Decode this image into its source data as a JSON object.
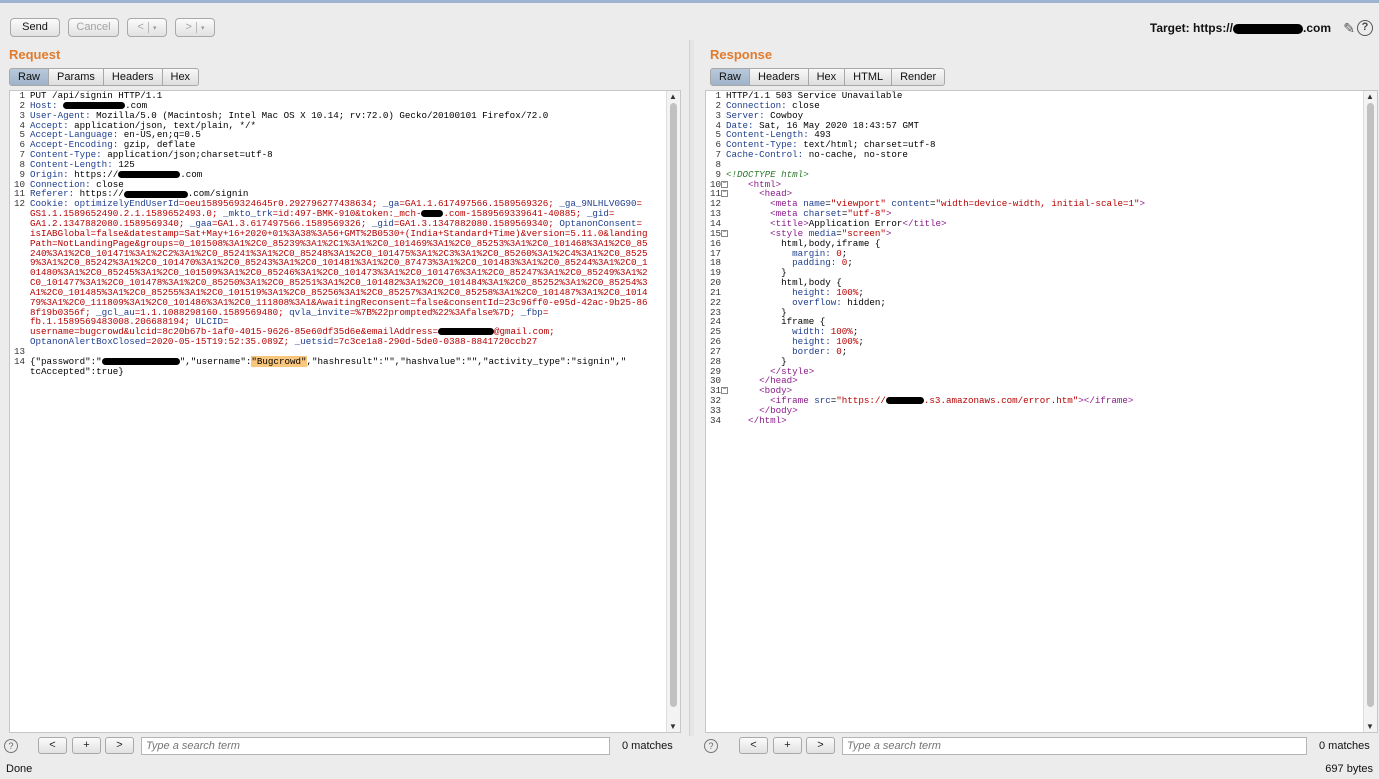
{
  "toolbar": {
    "send_label": "Send",
    "cancel_label": "Cancel",
    "back_label": "<",
    "forward_label": ">",
    "dropdown_glyph": "▾",
    "target_prefix": "Target: https://",
    "target_suffix": ".com"
  },
  "request": {
    "title": "Request",
    "tabs": [
      "Raw",
      "Params",
      "Headers",
      "Hex"
    ],
    "active_tab": "Raw",
    "lines": [
      {
        "n": "1",
        "parts": [
          {
            "t": "PUT /api/signin HTTP/1.1",
            "c": "val"
          }
        ]
      },
      {
        "n": "2",
        "parts": [
          {
            "t": "Host: ",
            "c": "hdr"
          },
          {
            "t": "",
            "c": "redact",
            "w": 62
          },
          {
            "t": ".com",
            "c": "val"
          }
        ]
      },
      {
        "n": "3",
        "parts": [
          {
            "t": "User-Agent: ",
            "c": "hdr"
          },
          {
            "t": "Mozilla/5.0 (Macintosh; Intel Mac OS X 10.14; rv:72.0) Gecko/20100101 Firefox/72.0",
            "c": "val"
          }
        ]
      },
      {
        "n": "4",
        "parts": [
          {
            "t": "Accept: ",
            "c": "hdr"
          },
          {
            "t": "application/json, text/plain, */*",
            "c": "val"
          }
        ]
      },
      {
        "n": "5",
        "parts": [
          {
            "t": "Accept-Language: ",
            "c": "hdr"
          },
          {
            "t": "en-US,en;q=0.5",
            "c": "val"
          }
        ]
      },
      {
        "n": "6",
        "parts": [
          {
            "t": "Accept-Encoding: ",
            "c": "hdr"
          },
          {
            "t": "gzip, deflate",
            "c": "val"
          }
        ]
      },
      {
        "n": "7",
        "parts": [
          {
            "t": "Content-Type: ",
            "c": "hdr"
          },
          {
            "t": "application/json;charset=utf-8",
            "c": "val"
          }
        ]
      },
      {
        "n": "8",
        "parts": [
          {
            "t": "Content-Length: ",
            "c": "hdr"
          },
          {
            "t": "125",
            "c": "val"
          }
        ]
      },
      {
        "n": "9",
        "parts": [
          {
            "t": "Origin: ",
            "c": "hdr"
          },
          {
            "t": "https://",
            "c": "val"
          },
          {
            "t": "",
            "c": "redact",
            "w": 62
          },
          {
            "t": ".com",
            "c": "val"
          }
        ]
      },
      {
        "n": "10",
        "parts": [
          {
            "t": "Connection: ",
            "c": "hdr"
          },
          {
            "t": "close",
            "c": "val"
          }
        ]
      },
      {
        "n": "11",
        "parts": [
          {
            "t": "Referer: ",
            "c": "hdr"
          },
          {
            "t": "https://",
            "c": "val"
          },
          {
            "t": "",
            "c": "redact",
            "w": 64
          },
          {
            "t": ".com/signin",
            "c": "val"
          }
        ]
      },
      {
        "n": "12",
        "parts": [
          {
            "t": "Cookie: ",
            "c": "hdr"
          },
          {
            "t": "optimizelyEndUserId",
            "c": "ck"
          },
          {
            "t": "=oeu1589569324645r0.292796277438634; ",
            "c": "cv"
          },
          {
            "t": "_ga",
            "c": "ck"
          },
          {
            "t": "=GA1.1.617497566.1589569326; ",
            "c": "cv"
          },
          {
            "t": "_ga_9NLHLV0G90",
            "c": "ck"
          },
          {
            "t": "=",
            "c": "cv"
          }
        ]
      },
      {
        "n": "",
        "parts": [
          {
            "t": "GS1.1.1589652490.2.1.1589652493.0; ",
            "c": "cv"
          },
          {
            "t": "_mkto_trk",
            "c": "ck"
          },
          {
            "t": "=id:497-BMK-910&token:_mch-",
            "c": "cv"
          },
          {
            "t": "",
            "c": "redact",
            "w": 22
          },
          {
            "t": ".com-1589569339641-40885; ",
            "c": "cv"
          },
          {
            "t": "_gid",
            "c": "ck"
          },
          {
            "t": "=",
            "c": "cv"
          }
        ]
      },
      {
        "n": "",
        "parts": [
          {
            "t": "GA1.2.1347882080.1589569340; ",
            "c": "cv"
          },
          {
            "t": "_gaa",
            "c": "ck"
          },
          {
            "t": "=GA1.3.617497566.1589569326; ",
            "c": "cv"
          },
          {
            "t": "_gid",
            "c": "ck"
          },
          {
            "t": "=GA1.3.1347882080.1589569340; ",
            "c": "cv"
          },
          {
            "t": "OptanonConsent",
            "c": "ck"
          },
          {
            "t": "=",
            "c": "cv"
          }
        ]
      },
      {
        "n": "",
        "parts": [
          {
            "t": "isIABGlobal=false&datestamp=Sat+May+16+2020+01%3A38%3A56+GMT%2B0530+(India+Standard+Time)&version=5.11.0&landing",
            "c": "cv"
          }
        ]
      },
      {
        "n": "",
        "parts": [
          {
            "t": "Path=NotLandingPage&groups=0_101508%3A1%2C0_85239%3A1%2C1%3A1%2C0_101469%3A1%2C0_85253%3A1%2C0_101468%3A1%2C0_85",
            "c": "cv"
          }
        ]
      },
      {
        "n": "",
        "parts": [
          {
            "t": "240%3A1%2C0_101471%3A1%2C2%3A1%2C0_85241%3A1%2C0_85248%3A1%2C0_101475%3A1%2C3%3A1%2C0_85260%3A1%2C4%3A1%2C0_8525",
            "c": "cv"
          }
        ]
      },
      {
        "n": "",
        "parts": [
          {
            "t": "9%3A1%2C0_85242%3A1%2C0_101470%3A1%2C0_85243%3A1%2C0_101481%3A1%2C0_87473%3A1%2C0_101483%3A1%2C0_85244%3A1%2C0_1",
            "c": "cv"
          }
        ]
      },
      {
        "n": "",
        "parts": [
          {
            "t": "01480%3A1%2C0_85245%3A1%2C0_101509%3A1%2C0_85246%3A1%2C0_101473%3A1%2C0_101476%3A1%2C0_85247%3A1%2C0_85249%3A1%2",
            "c": "cv"
          }
        ]
      },
      {
        "n": "",
        "parts": [
          {
            "t": "C0_101477%3A1%2C0_101478%3A1%2C0_85250%3A1%2C0_85251%3A1%2C0_101482%3A1%2C0_101484%3A1%2C0_85252%3A1%2C0_85254%3",
            "c": "cv"
          }
        ]
      },
      {
        "n": "",
        "parts": [
          {
            "t": "A1%2C0_101485%3A1%2C0_85255%3A1%2C0_101519%3A1%2C0_85256%3A1%2C0_85257%3A1%2C0_85258%3A1%2C0_101487%3A1%2C0_1014",
            "c": "cv"
          }
        ]
      },
      {
        "n": "",
        "parts": [
          {
            "t": "79%3A1%2C0_111809%3A1%2C0_101486%3A1%2C0_111808%3A1&AwaitingReconsent=false&consentId=23c96ff0-e95d-42ac-9b25-86",
            "c": "cv"
          }
        ]
      },
      {
        "n": "",
        "parts": [
          {
            "t": "8f19b0356f; ",
            "c": "cv"
          },
          {
            "t": "_gcl_au",
            "c": "ck"
          },
          {
            "t": "=1.1.1088298160.1589569480; ",
            "c": "cv"
          },
          {
            "t": "qvla_invite",
            "c": "ck"
          },
          {
            "t": "=%7B%22prompted%22%3Afalse%7D; ",
            "c": "cv"
          },
          {
            "t": "_fbp",
            "c": "ck"
          },
          {
            "t": "=",
            "c": "cv"
          }
        ]
      },
      {
        "n": "",
        "parts": [
          {
            "t": "fb.1.1589569483008.206688194; ",
            "c": "cv"
          },
          {
            "t": "ULCID",
            "c": "ck"
          },
          {
            "t": "=",
            "c": "cv"
          }
        ]
      },
      {
        "n": "",
        "parts": [
          {
            "t": "username=bugcrowd&ulcid=8c20b67b-1af0-4015-9626-85e60df35d6e&emailAddress=",
            "c": "cv"
          },
          {
            "t": "",
            "c": "redact",
            "w": 56
          },
          {
            "t": "@gmail.com;",
            "c": "cv"
          }
        ]
      },
      {
        "n": "",
        "parts": [
          {
            "t": "OptanonAlertBoxClosed",
            "c": "ck"
          },
          {
            "t": "=2020-05-15T19:52:35.089Z; ",
            "c": "cv"
          },
          {
            "t": "_uetsid",
            "c": "ck"
          },
          {
            "t": "=7c3ce1a8-290d-5de0-0388-8841720ccb27",
            "c": "cv"
          }
        ]
      },
      {
        "n": "13",
        "parts": []
      },
      {
        "n": "14",
        "parts": [
          {
            "t": "{\"password\":\"",
            "c": "val"
          },
          {
            "t": "",
            "c": "redact",
            "w": 78
          },
          {
            "t": "\",\"username\":",
            "c": "val"
          },
          {
            "t": "\"Bugcrowd\"",
            "c": "hl"
          },
          {
            "t": ",\"hashresult\":\"\",\"hashvalue\":\"\",\"activity_type\":\"signin\",\"",
            "c": "val"
          }
        ]
      },
      {
        "n": "",
        "parts": [
          {
            "t": "tcAccepted\":true}",
            "c": "val"
          }
        ]
      }
    ],
    "search_placeholder": "Type a search term",
    "matches": "0 matches"
  },
  "response": {
    "title": "Response",
    "tabs": [
      "Raw",
      "Headers",
      "Hex",
      "HTML",
      "Render"
    ],
    "active_tab": "Raw",
    "lines": [
      {
        "n": "1",
        "parts": [
          {
            "t": "HTTP/1.1 503 Service Unavailable",
            "c": "val"
          }
        ]
      },
      {
        "n": "2",
        "parts": [
          {
            "t": "Connection: ",
            "c": "hdr"
          },
          {
            "t": "close",
            "c": "val"
          }
        ]
      },
      {
        "n": "3",
        "parts": [
          {
            "t": "Server: ",
            "c": "hdr"
          },
          {
            "t": "Cowboy",
            "c": "val"
          }
        ]
      },
      {
        "n": "4",
        "parts": [
          {
            "t": "Date: ",
            "c": "hdr"
          },
          {
            "t": "Sat, 16 May 2020 18:43:57 GMT",
            "c": "val"
          }
        ]
      },
      {
        "n": "5",
        "parts": [
          {
            "t": "Content-Length: ",
            "c": "hdr"
          },
          {
            "t": "493",
            "c": "val"
          }
        ]
      },
      {
        "n": "6",
        "parts": [
          {
            "t": "Content-Type: ",
            "c": "hdr"
          },
          {
            "t": "text/html; charset=utf-8",
            "c": "val"
          }
        ]
      },
      {
        "n": "7",
        "parts": [
          {
            "t": "Cache-Control: ",
            "c": "hdr"
          },
          {
            "t": "no-cache, no-store",
            "c": "val"
          }
        ]
      },
      {
        "n": "8",
        "parts": []
      },
      {
        "n": "9",
        "parts": [
          {
            "t": "<!DOCTYPE html>",
            "c": "doct"
          }
        ]
      },
      {
        "n": "10",
        "fold": true,
        "parts": [
          {
            "t": "    <",
            "c": "tagc"
          },
          {
            "t": "html",
            "c": "tagc"
          },
          {
            "t": ">",
            "c": "tagc"
          }
        ]
      },
      {
        "n": "11",
        "fold": true,
        "parts": [
          {
            "t": "      <head>",
            "c": "tagc"
          }
        ]
      },
      {
        "n": "12",
        "parts": [
          {
            "t": "        <meta ",
            "c": "tagc"
          },
          {
            "t": "name",
            "c": "attr"
          },
          {
            "t": "=",
            "c": "val"
          },
          {
            "t": "\"viewport\"",
            "c": "aval"
          },
          {
            "t": " content",
            "c": "attr"
          },
          {
            "t": "=",
            "c": "val"
          },
          {
            "t": "\"width=device-width, initial-scale=1\"",
            "c": "aval"
          },
          {
            "t": ">",
            "c": "tagc"
          }
        ]
      },
      {
        "n": "13",
        "parts": [
          {
            "t": "        <meta ",
            "c": "tagc"
          },
          {
            "t": "charset",
            "c": "attr"
          },
          {
            "t": "=",
            "c": "val"
          },
          {
            "t": "\"utf-8\"",
            "c": "aval"
          },
          {
            "t": ">",
            "c": "tagc"
          }
        ]
      },
      {
        "n": "14",
        "parts": [
          {
            "t": "        <title>",
            "c": "tagc"
          },
          {
            "t": "Application Error",
            "c": "val"
          },
          {
            "t": "</title>",
            "c": "tagc"
          }
        ]
      },
      {
        "n": "15",
        "fold": true,
        "parts": [
          {
            "t": "        <style ",
            "c": "tagc"
          },
          {
            "t": "media",
            "c": "attr"
          },
          {
            "t": "=",
            "c": "val"
          },
          {
            "t": "\"screen\"",
            "c": "aval"
          },
          {
            "t": ">",
            "c": "tagc"
          }
        ]
      },
      {
        "n": "16",
        "parts": [
          {
            "t": "          html,body,iframe {",
            "c": "val"
          }
        ]
      },
      {
        "n": "17",
        "parts": [
          {
            "t": "            margin: ",
            "c": "hdr"
          },
          {
            "t": "0",
            "c": "cv"
          },
          {
            "t": ";",
            "c": "val"
          }
        ]
      },
      {
        "n": "18",
        "parts": [
          {
            "t": "            padding: ",
            "c": "hdr"
          },
          {
            "t": "0",
            "c": "cv"
          },
          {
            "t": ";",
            "c": "val"
          }
        ]
      },
      {
        "n": "19",
        "parts": [
          {
            "t": "          }",
            "c": "val"
          }
        ]
      },
      {
        "n": "20",
        "parts": [
          {
            "t": "          html,body {",
            "c": "val"
          }
        ]
      },
      {
        "n": "21",
        "parts": [
          {
            "t": "            height: ",
            "c": "hdr"
          },
          {
            "t": "100%",
            "c": "cv"
          },
          {
            "t": ";",
            "c": "val"
          }
        ]
      },
      {
        "n": "22",
        "parts": [
          {
            "t": "            overflow: ",
            "c": "hdr"
          },
          {
            "t": "hidden",
            "c": "val"
          },
          {
            "t": ";",
            "c": "val"
          }
        ]
      },
      {
        "n": "23",
        "parts": [
          {
            "t": "          }",
            "c": "val"
          }
        ]
      },
      {
        "n": "24",
        "parts": [
          {
            "t": "          iframe {",
            "c": "val"
          }
        ]
      },
      {
        "n": "25",
        "parts": [
          {
            "t": "            width: ",
            "c": "hdr"
          },
          {
            "t": "100%",
            "c": "cv"
          },
          {
            "t": ";",
            "c": "val"
          }
        ]
      },
      {
        "n": "26",
        "parts": [
          {
            "t": "            height: ",
            "c": "hdr"
          },
          {
            "t": "100%",
            "c": "cv"
          },
          {
            "t": ";",
            "c": "val"
          }
        ]
      },
      {
        "n": "27",
        "parts": [
          {
            "t": "            border: ",
            "c": "hdr"
          },
          {
            "t": "0",
            "c": "cv"
          },
          {
            "t": ";",
            "c": "val"
          }
        ]
      },
      {
        "n": "28",
        "parts": [
          {
            "t": "          }",
            "c": "val"
          }
        ]
      },
      {
        "n": "29",
        "parts": [
          {
            "t": "        </style>",
            "c": "tagc"
          }
        ]
      },
      {
        "n": "30",
        "parts": [
          {
            "t": "      </head>",
            "c": "tagc"
          }
        ]
      },
      {
        "n": "31",
        "fold": true,
        "parts": [
          {
            "t": "      <body>",
            "c": "tagc"
          }
        ]
      },
      {
        "n": "32",
        "parts": [
          {
            "t": "        <iframe ",
            "c": "tagc"
          },
          {
            "t": "src",
            "c": "attr"
          },
          {
            "t": "=",
            "c": "val"
          },
          {
            "t": "\"https://",
            "c": "aval"
          },
          {
            "t": "",
            "c": "redact",
            "w": 38
          },
          {
            "t": ".s3.amazonaws.com/error.htm\"",
            "c": "aval"
          },
          {
            "t": "></iframe>",
            "c": "tagc"
          }
        ]
      },
      {
        "n": "33",
        "parts": [
          {
            "t": "      </body>",
            "c": "tagc"
          }
        ]
      },
      {
        "n": "34",
        "parts": [
          {
            "t": "    </html>",
            "c": "tagc"
          }
        ]
      }
    ],
    "search_placeholder": "Type a search term",
    "matches": "0 matches"
  },
  "search_buttons": {
    "prev": "<",
    "add": "+",
    "next": ">",
    "help": "?"
  },
  "status": {
    "left": "Done",
    "right": "697 bytes"
  },
  "colors": {
    "accent": "#e07c2f",
    "active_tab": "#a9bbcf",
    "highlight": "#f9c67d"
  }
}
